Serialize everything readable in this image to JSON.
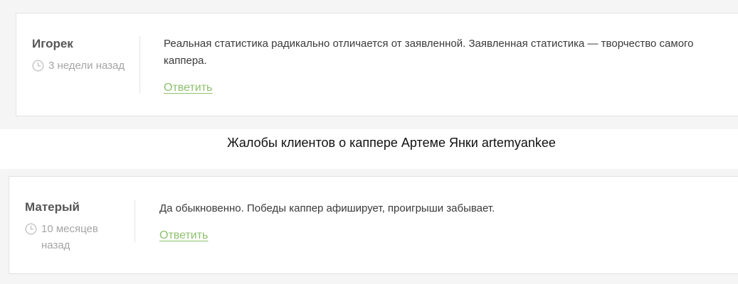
{
  "comments": [
    {
      "author": "Игорек",
      "time": "3 недели назад",
      "text": "Реальная статистика радикально отличается от заявленной. Заявленная статистика — творчество самого каппера.",
      "reply_label": "Ответить"
    },
    {
      "author": "Матерый",
      "time_line1": "10 месяцев",
      "time_line2": "назад",
      "text": "Да обыкновенно. Победы каппер афиширует, проигрыши забывает.",
      "reply_label": "Ответить"
    }
  ],
  "section_heading": "Жалобы клиентов о каппере Артеме Янки artemyankee",
  "icons": {
    "time": "clock-icon"
  },
  "colors": {
    "accent": "#8dc16c",
    "muted": "#a5a5a5",
    "author": "#555555",
    "text": "#3a3a3a",
    "background": "#f5f5f5",
    "border": "#e3e3e3"
  }
}
